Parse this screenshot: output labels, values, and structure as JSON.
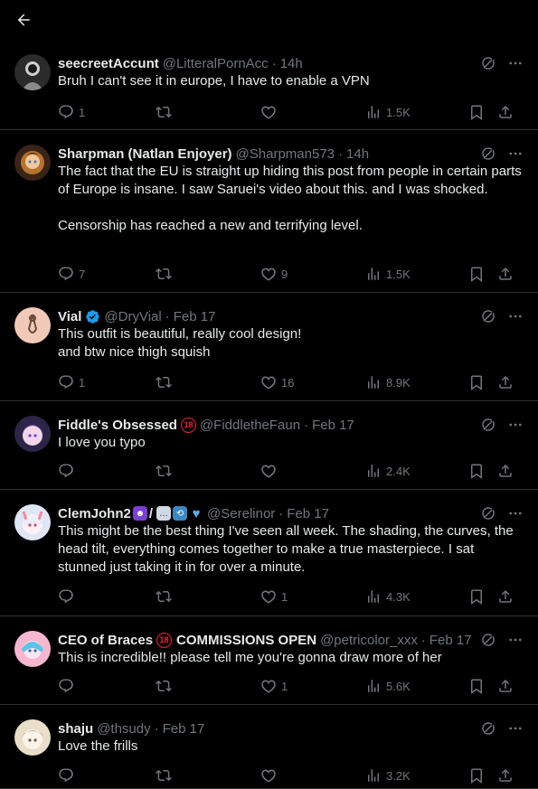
{
  "topbar": {
    "back_icon": "arrow-left-icon"
  },
  "tweets": [
    {
      "name": "seecreetAccunt",
      "handle": "@LitteralPornAcc",
      "time": "14h",
      "text": "Bruh I can't see it in europe, I have to enable a VPN",
      "replies": "1",
      "retweets": "",
      "likes": "",
      "views": "1.5K",
      "avatar_color": "#3a3a3a"
    },
    {
      "name": "Sharpman (Natlan Enjoyer)",
      "handle": "@Sharpman573",
      "time": "14h",
      "text": "The fact that the EU is straight up hiding this post from people in certain parts of Europe is insane. I saw Saruei's video about this. and I was shocked.\n\nCensorship has reached a new and terrifying level.",
      "replies": "7",
      "retweets": "",
      "likes": "9",
      "views": "1.5K",
      "avatar_color": "#7a4a2c"
    },
    {
      "name": "Vial",
      "handle": "@DryVial",
      "time": "Feb 17",
      "text": "This outfit is beautiful, really cool design!\nand btw nice thigh squish",
      "replies": "1",
      "retweets": "",
      "likes": "16",
      "views": "8.9K",
      "avatar_color": "#f2c9b8",
      "verified": true
    },
    {
      "name": "Fiddle's Obsessed",
      "handle": "@FiddletheFaun",
      "time": "Feb 17",
      "text": "I love you typo",
      "replies": "",
      "retweets": "",
      "likes": "",
      "views": "2.4K",
      "avatar_color": "#5b4a8a",
      "age_badge": "18"
    },
    {
      "name": "ClemJohn2",
      "handle": "@Serelinor",
      "time": "Feb 17",
      "text": "This might be the best thing I've seen all week. The shading, the curves, the head tilt, everything comes together to make a true masterpiece. I sat stunned just taking it in for over a minute.",
      "replies": "",
      "retweets": "",
      "likes": "1",
      "views": "4.3K",
      "avatar_color": "#cfd8f0",
      "name_suffix": "/"
    },
    {
      "name": "CEO of Braces",
      "name_extra": "COMMISSIONS OPEN",
      "handle": "@petricolor_xxx",
      "time": "Feb 17",
      "text": "This is incredible!! please tell me you're gonna draw more of her",
      "replies": "",
      "retweets": "",
      "likes": "1",
      "views": "5.6K",
      "avatar_color": "#e88ab5",
      "age_badge": "18"
    },
    {
      "name": "shaju",
      "handle": "@thsudy",
      "time": "Feb 17",
      "text": "Love the frills",
      "replies": "",
      "retweets": "",
      "likes": "",
      "views": "3.2K",
      "avatar_color": "#d9c9a8"
    }
  ]
}
